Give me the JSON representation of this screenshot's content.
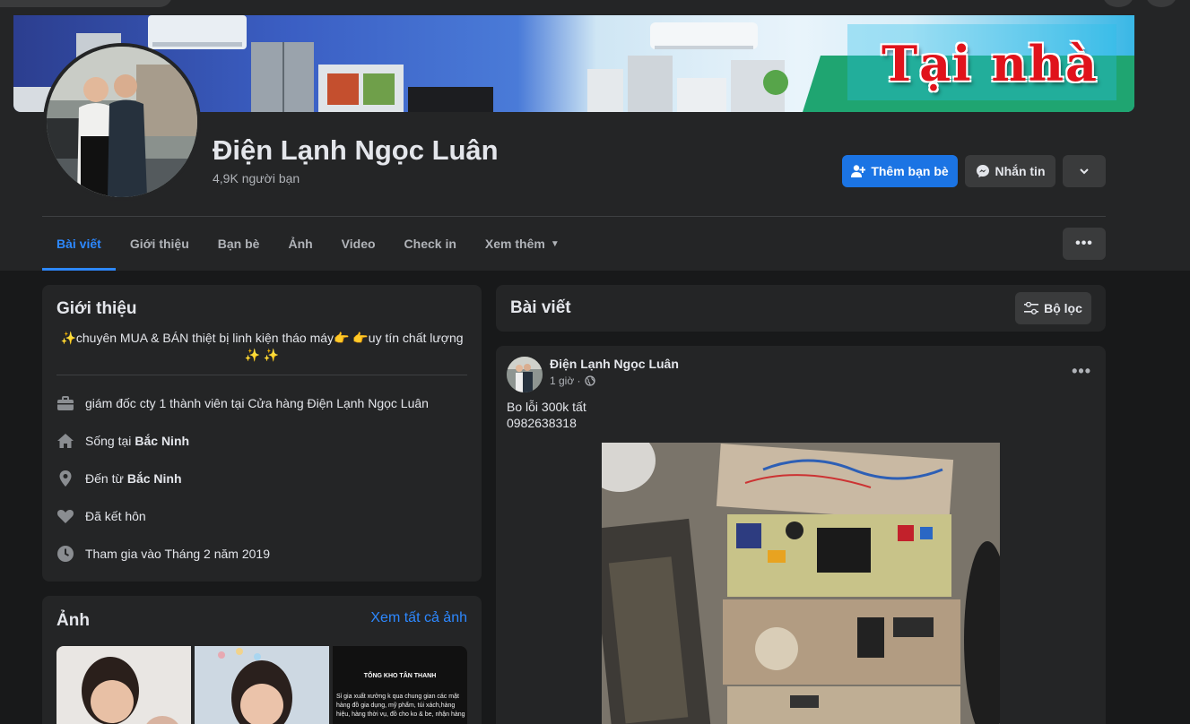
{
  "colors": {
    "accent": "#2d88ff",
    "primary_button": "#1b74e4",
    "card": "#242526",
    "page": "#18191a"
  },
  "cover": {
    "text": "Tại nhà"
  },
  "profile": {
    "name": "Điện Lạnh Ngọc Luân",
    "friend_count": "4,9K người bạn"
  },
  "actions": {
    "add_friend": "Thêm bạn bè",
    "message": "Nhắn tin"
  },
  "tabs": [
    {
      "label": "Bài viết",
      "active": true
    },
    {
      "label": "Giới thiệu"
    },
    {
      "label": "Bạn bè"
    },
    {
      "label": "Ảnh"
    },
    {
      "label": "Video"
    },
    {
      "label": "Check in"
    },
    {
      "label": "Xem thêm"
    }
  ],
  "intro": {
    "title": "Giới thiệu",
    "bio_line1": "✨chuyên MUA & BÁN thiệt bị linh kiện tháo máy👉 👉uy tín chất lượng",
    "bio_line2": "✨ ✨",
    "work": "giám đốc cty 1 thành viên tại Cửa hàng Điện Lạnh Ngọc Luân",
    "lives_prefix": "Sống tại",
    "lives_place": "Bắc Ninh",
    "from_prefix": "Đến từ",
    "from_place": "Bắc Ninh",
    "relationship": "Đã kết hôn",
    "joined": "Tham gia vào Tháng 2 năm 2019"
  },
  "photos": {
    "title": "Ảnh",
    "see_all": "Xem tất cả ảnh",
    "thumb3_title": "TỔNG KHO TÂN THANH",
    "thumb3_text": "Sỉ gia xuất xưởng k qua chung gian các mặt hàng đồ gia dụng, mỹ phẩm, túi xách,hàng hiệu, hàng thời vụ, đồ cho ko & be, nhận hàng"
  },
  "feed": {
    "title": "Bài viết",
    "filter_label": "Bộ lọc"
  },
  "post": {
    "author": "Điện Lạnh Ngọc Luân",
    "time": "1 giờ ·",
    "text_line1": "Bo lỗi 300k tất",
    "text_line2": "0982638318"
  }
}
